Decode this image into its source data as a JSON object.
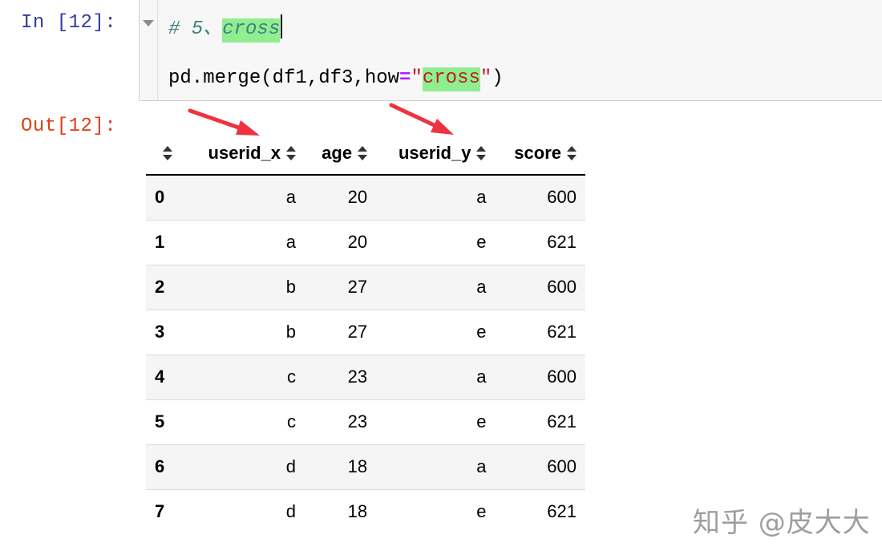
{
  "input_prompt": "In [12]:",
  "output_prompt": "Out[12]:",
  "code": {
    "comment_prefix": "# 5、",
    "comment_highlight": "cross",
    "line2_prefix": "pd.merge(df1,df3,how",
    "line2_op": "=",
    "line2_quote_open": "\"",
    "line2_string_highlight": "cross",
    "line2_quote_close": "\"",
    "line2_suffix": ")"
  },
  "table": {
    "columns": [
      "userid_x",
      "age",
      "userid_y",
      "score"
    ],
    "rows": [
      {
        "index": "0",
        "cells": [
          "a",
          "20",
          "a",
          "600"
        ]
      },
      {
        "index": "1",
        "cells": [
          "a",
          "20",
          "e",
          "621"
        ]
      },
      {
        "index": "2",
        "cells": [
          "b",
          "27",
          "a",
          "600"
        ]
      },
      {
        "index": "3",
        "cells": [
          "b",
          "27",
          "e",
          "621"
        ]
      },
      {
        "index": "4",
        "cells": [
          "c",
          "23",
          "a",
          "600"
        ]
      },
      {
        "index": "5",
        "cells": [
          "c",
          "23",
          "e",
          "621"
        ]
      },
      {
        "index": "6",
        "cells": [
          "d",
          "18",
          "a",
          "600"
        ]
      },
      {
        "index": "7",
        "cells": [
          "d",
          "18",
          "e",
          "621"
        ]
      }
    ]
  },
  "watermark": "知乎 @皮大大",
  "colors": {
    "input_prompt": "#303f9f",
    "output_prompt": "#d84315",
    "highlight": "#90ee90",
    "annotation_arrow": "#ee3340"
  }
}
